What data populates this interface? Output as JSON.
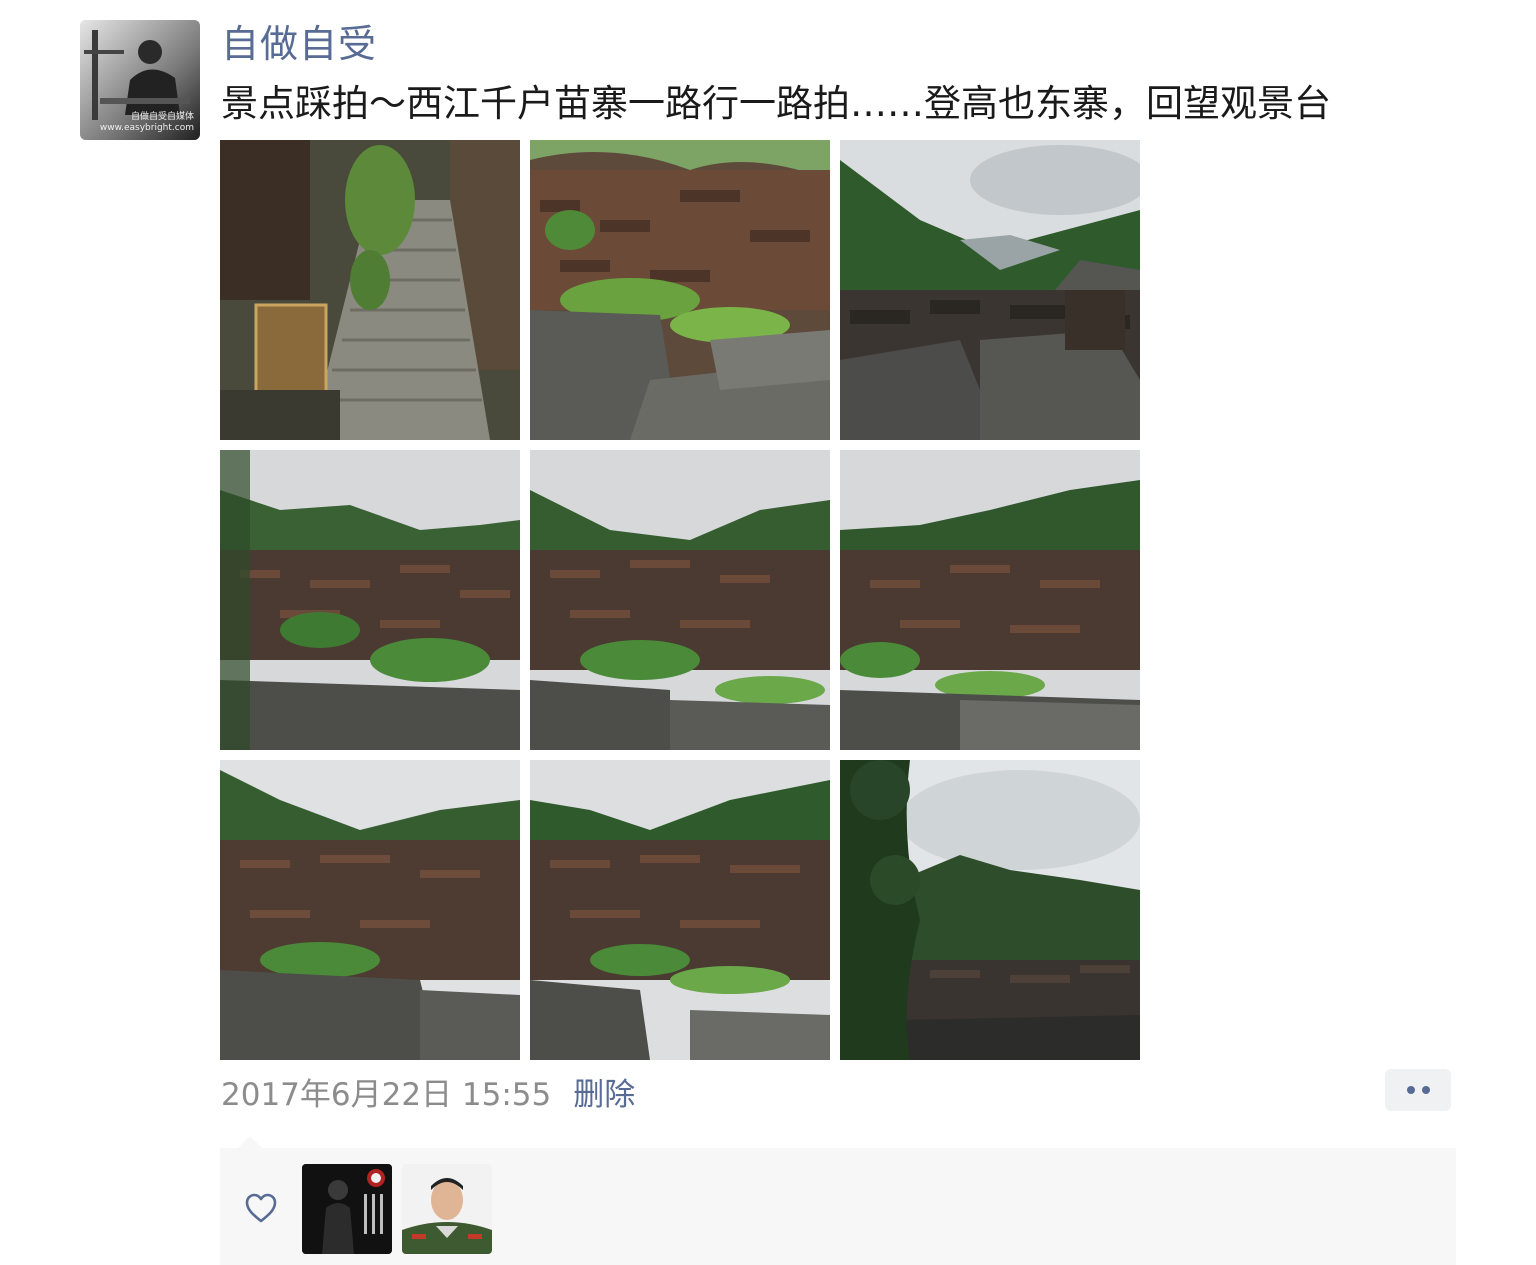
{
  "post": {
    "username": "自做自受",
    "text": "景点踩拍～西江千户苗寨一路行一路拍……登高也东寨，回望观景台",
    "timestamp": "2017年6月22日 15:55",
    "delete_label": "删除",
    "avatar_caption": "自做自受自媒体\nwww.easybright.com"
  },
  "photos": [
    {
      "name": "stone-stairs-photo",
      "scene": "stairs"
    },
    {
      "name": "village-rooftops-photo",
      "scene": "village"
    },
    {
      "name": "valley-view-photo",
      "scene": "valley"
    },
    {
      "name": "village-hillside-photo-1",
      "scene": "hillside"
    },
    {
      "name": "village-hillside-photo-2",
      "scene": "hillside"
    },
    {
      "name": "village-hillside-photo-3",
      "scene": "hillside"
    },
    {
      "name": "village-hillside-photo-4",
      "scene": "hillside"
    },
    {
      "name": "village-hillside-photo-5",
      "scene": "hillside"
    },
    {
      "name": "misty-mountain-photo",
      "scene": "misty"
    }
  ],
  "icons": {
    "more": "more-dots-icon",
    "like": "heart-icon"
  },
  "colors": {
    "link": "#576b95",
    "timestamp": "#8c8c8c",
    "likes_bg": "#f7f7f7"
  }
}
